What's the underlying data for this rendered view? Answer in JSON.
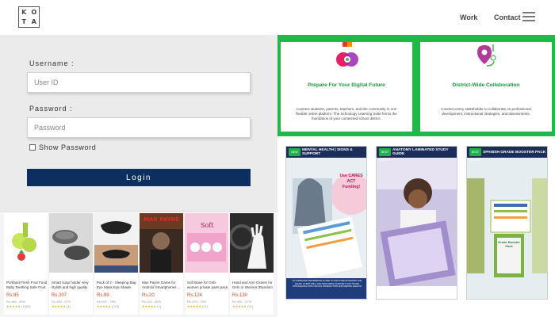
{
  "header": {
    "logo_letters": [
      "K",
      "O",
      "T",
      "A"
    ],
    "nav": {
      "work": "Work",
      "contact": "Contact"
    },
    "menu_icon": "hamburger-icon"
  },
  "login": {
    "username_label": "Username :",
    "username_placeholder": "User ID",
    "password_label": "Password :",
    "password_placeholder": "Password",
    "show_password_label": "Show Password",
    "login_button": "Login"
  },
  "products": [
    {
      "title": "Portland Fresh Fruit Food Baby Teething Safe Fruit",
      "price": "Rs.95",
      "old_price": "Rs.469 - 80%",
      "reviews": "(1563)"
    },
    {
      "title": "Smart soap holder very stylish and high quality box",
      "price": "Rs.207",
      "old_price": "Rs.490 - 57%",
      "reviews": "(4)"
    },
    {
      "title": "Pack of 2 - Sleeping Bag Eye Mask Eye Shade Cover",
      "price": "Rs.99",
      "old_price": "Rs.399 - 75%",
      "reviews": "(213)"
    },
    {
      "title": "Max Payne Game for Android Smartphones ...",
      "price": "Rs.20",
      "old_price": "Rs.100 - 80%",
      "reviews": "(7)"
    },
    {
      "title": "Soft Base for Girls women private parts pack of 4",
      "price": "Rs.124",
      "old_price": "Rs.499 - 75%",
      "reviews": "(21)"
    },
    {
      "title": "Hand and Arm Gloves for Girls or Women (Random ...",
      "price": "Rs.130",
      "old_price": "Rs.400 - 67%",
      "reviews": "(31)"
    }
  ],
  "features": [
    {
      "icon": "puzzle-icon",
      "title": "Prepare For Your Digital Future",
      "text": "Connect students, parents, teachers, and the community in one flexible online platform. The Schoology Learning Suite forms the foundation of your connected school district."
    },
    {
      "icon": "location-pin-icon",
      "title": "District-Wide Collaboration",
      "text": "Connect every stakeholder to collaborate on professional development, instructional strategies, and assessments."
    }
  ],
  "posters": [
    {
      "badge": "NEW",
      "header": "MENTAL HEALTH | SIGNS & SUPPORT",
      "headline": "Use CARES ACT Funding!",
      "footer": "10 LAMINATED REFERENCE GUIDE TO AID IN RECOGNIZING THE SIGNS, SYMPTOMS, AND PROVIDING SUPPORT FOR THOSE STRUGGLING WITH SOCIAL INTERACTION AND MENTAL HEALTH"
    },
    {
      "badge": "BEST SELLER",
      "header": "ANATOMY LAMINATED STUDY GUIDE",
      "headline": "",
      "footer": ""
    },
    {
      "badge": "BEST SELLER",
      "header": "SPANISH GRADE BOOSTER PACK",
      "headline": "Grade Booster Pack",
      "footer": ""
    }
  ],
  "colors": {
    "green": "#21b849",
    "navy": "#0d2f5f",
    "price": "#e2491a"
  }
}
